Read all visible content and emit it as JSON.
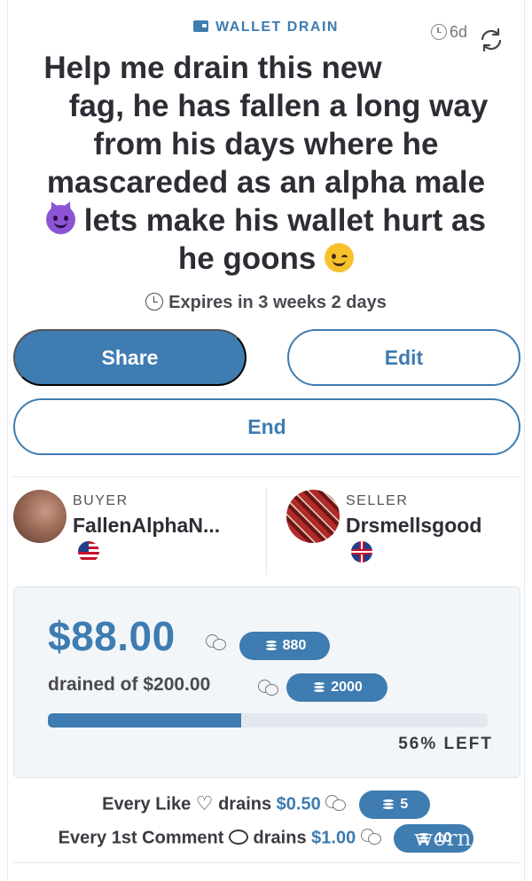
{
  "header": {
    "category_label": "WALLET DRAIN",
    "category_icon": "wallet-icon",
    "age": "6d",
    "refresh_icon": "refresh-icon"
  },
  "title_lines": [
    "Help me drain this new",
    "fag, he has fallen a long way",
    "from his days where he",
    "mascareded as an alpha male",
    "lets make his wallet hurt as",
    "he goons"
  ],
  "title_emojis": [
    "smiling-face-with-horns",
    "winking-face"
  ],
  "expires": "Expires in 3 weeks 2 days",
  "actions": {
    "share": "Share",
    "edit": "Edit",
    "end": "End"
  },
  "buyer": {
    "role": "BUYER",
    "username": "FallenAlphaN...",
    "flag": "US"
  },
  "seller": {
    "role": "SELLER",
    "username": "Drsmellsgood",
    "flag": "UK"
  },
  "drain": {
    "amount": "$88.00",
    "amount_coins": "880",
    "drained_text": "drained of $200.00",
    "goal_coins": "2000",
    "progress_fraction": 0.44,
    "left_label": "56% LEFT"
  },
  "rules": {
    "like_prefix": "Every Like",
    "like_verb": "drains",
    "like_price": "$0.50",
    "like_coins": "5",
    "comment_prefix": "Every 1st Comment",
    "comment_verb": "drains",
    "comment_price": "$1.00",
    "comment_coins": "10"
  },
  "watermark": "worn.c",
  "colors": {
    "accent": "#3e7cb1",
    "text": "#2d2d35",
    "panel": "#f3f6f9"
  }
}
